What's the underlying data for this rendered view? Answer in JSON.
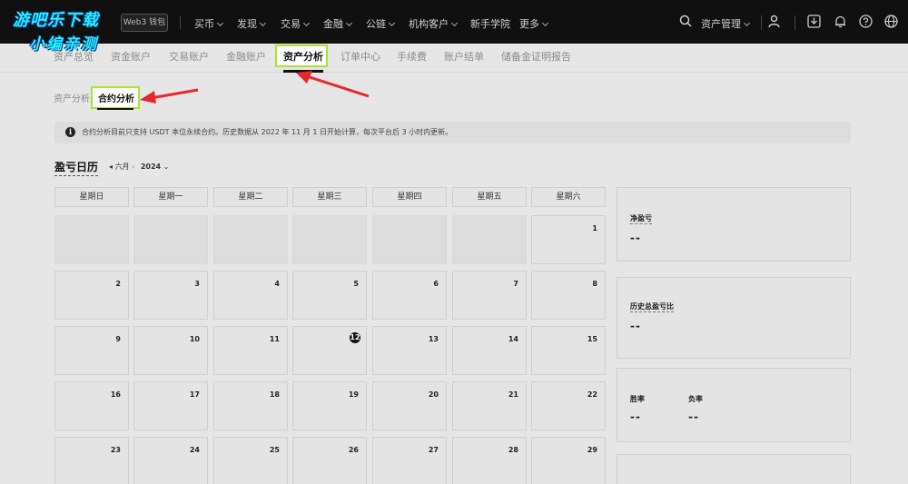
{
  "watermark": {
    "line1": "游吧乐下载",
    "line2": "小编亲测"
  },
  "topnav": {
    "wallet_label": "Web3 钱包",
    "items": [
      {
        "label": "买币",
        "caret": true
      },
      {
        "label": "发现",
        "caret": true
      },
      {
        "label": "交易",
        "caret": true
      },
      {
        "label": "金融",
        "caret": true
      },
      {
        "label": "公链",
        "caret": true
      },
      {
        "label": "机构客户",
        "caret": true
      },
      {
        "label": "新手学院",
        "caret": false
      },
      {
        "label": "更多",
        "caret": true
      }
    ],
    "asset_mgmt": "资产管理",
    "icons": [
      "search-icon",
      "user-icon",
      "download-icon",
      "bell-icon",
      "help-icon",
      "globe-icon"
    ]
  },
  "subnav": {
    "tabs": [
      "资产总览",
      "资金账户",
      "交易账户",
      "金融账户",
      "资产分析",
      "订单中心",
      "手续费",
      "账户结单",
      "储备金证明报告"
    ],
    "active_index": 4
  },
  "subnav2": {
    "inactive": "资产分析",
    "active": "合约分析"
  },
  "notice": {
    "text": "合约分析目前只支持 USDT 本位永续合约。历史数据从 2022 年 11 月 1 日开始计算，每次平台后 3 小时内更新。"
  },
  "calendar": {
    "title": "盈亏日历",
    "month": "六月",
    "year": "2024",
    "weekdays": [
      "星期日",
      "星期一",
      "星期二",
      "星期三",
      "星期四",
      "星期五",
      "星期六"
    ],
    "weeks": [
      [
        "",
        "",
        "",
        "",
        "",
        "",
        "1"
      ],
      [
        "2",
        "3",
        "4",
        "5",
        "6",
        "7",
        "8"
      ],
      [
        "9",
        "10",
        "11",
        "12",
        "13",
        "14",
        "15"
      ],
      [
        "16",
        "17",
        "18",
        "19",
        "20",
        "21",
        "22"
      ],
      [
        "23",
        "24",
        "25",
        "26",
        "27",
        "28",
        "29"
      ]
    ],
    "today": "12"
  },
  "stats": {
    "net_pnl_label": "净盈亏",
    "net_pnl_value": "--",
    "hist_ratio_label": "历史总盈亏比",
    "hist_ratio_value": "--",
    "win_label": "胜率",
    "win_value": "--",
    "loss_label": "负率",
    "loss_value": "--"
  },
  "colors": {
    "highlight": "#a9e334",
    "arrow": "#e8262b",
    "watermark": "#28f0ff"
  }
}
